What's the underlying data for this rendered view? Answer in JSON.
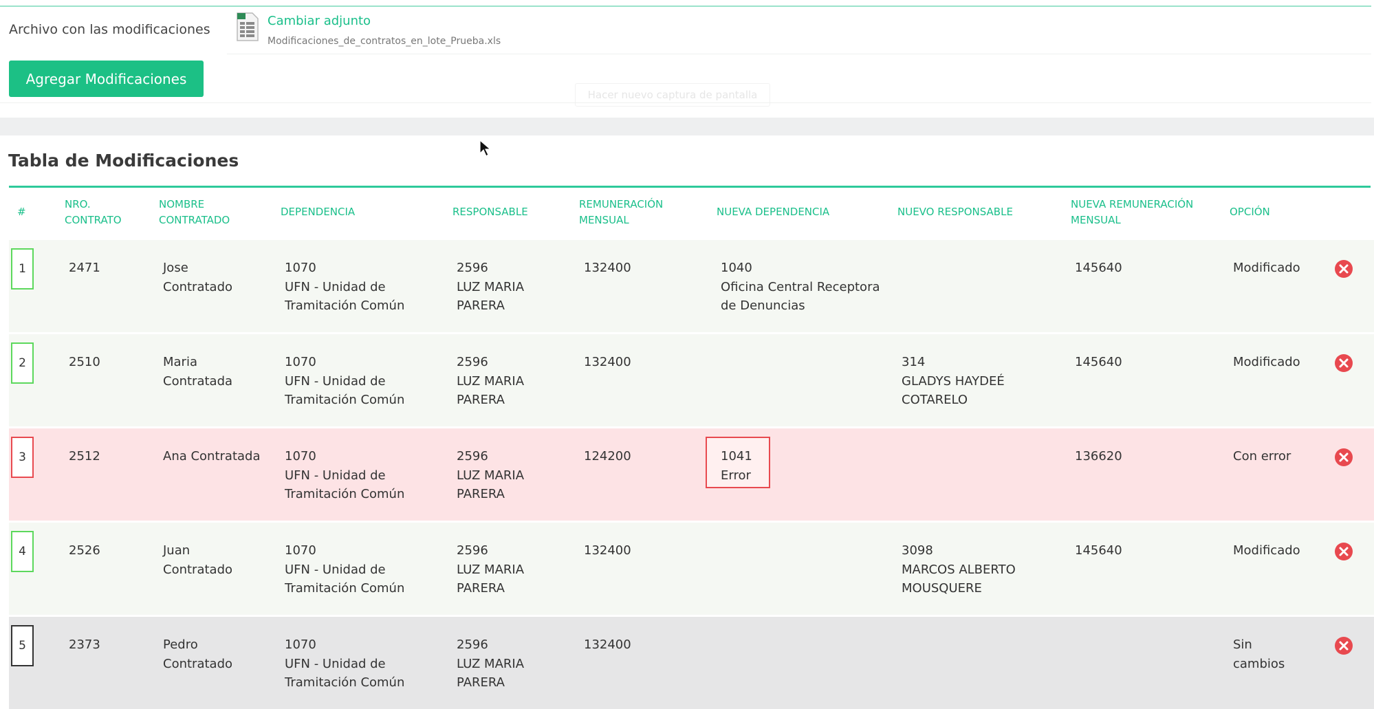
{
  "upload": {
    "label": "Archivo con las modificaciones",
    "change_link": "Cambiar adjunto",
    "file_name": "Modificaciones_de_contratos_en_lote_Prueba.xls",
    "add_button": "Agregar Modificaciones",
    "ghost_button": "Hacer nuevo captura de pantalla"
  },
  "table": {
    "title": "Tabla de Modificaciones",
    "headers": {
      "index": "#",
      "contract_1": "NRO.",
      "contract_2": "CONTRATO",
      "name_1": "NOMBRE",
      "name_2": "CONTRATADO",
      "dependency": "DEPENDENCIA",
      "responsible": "RESPONSABLE",
      "salary_1": "REMUNERACIÓN",
      "salary_2": "MENSUAL",
      "new_dependency": "NUEVA DEPENDENCIA",
      "new_responsible": "NUEVO RESPONSABLE",
      "new_salary_1": "NUEVA REMUNERACIÓN",
      "new_salary_2": "MENSUAL",
      "option": "OPCIÓN"
    },
    "rows": [
      {
        "index": "1",
        "status_type": "ok",
        "contract": "2471",
        "name": [
          "Jose",
          "Contratado"
        ],
        "dependency": [
          "1070",
          "UFN - Unidad de",
          "Tramitación Común"
        ],
        "responsible": [
          "2596",
          "LUZ MARIA",
          "PARERA"
        ],
        "salary": "132400",
        "new_dependency": [
          "1040",
          "Oficina Central Receptora",
          "de Denuncias"
        ],
        "new_responsible": [
          "",
          "",
          ""
        ],
        "new_salary": "145640",
        "option": [
          "Modificado",
          ""
        ]
      },
      {
        "index": "2",
        "status_type": "ok",
        "contract": "2510",
        "name": [
          "Maria",
          "Contratada"
        ],
        "dependency": [
          "1070",
          "UFN - Unidad de",
          "Tramitación Común"
        ],
        "responsible": [
          "2596",
          "LUZ MARIA",
          "PARERA"
        ],
        "salary": "132400",
        "new_dependency": [
          "",
          "",
          ""
        ],
        "new_responsible": [
          "314",
          "GLADYS HAYDEÉ",
          "COTARELO"
        ],
        "new_salary": "145640",
        "option": [
          "Modificado",
          ""
        ]
      },
      {
        "index": "3",
        "status_type": "err",
        "contract": "2512",
        "name": [
          "Ana Contratada",
          ""
        ],
        "dependency": [
          "1070",
          "UFN - Unidad de",
          "Tramitación Común"
        ],
        "responsible": [
          "2596",
          "LUZ MARIA",
          "PARERA"
        ],
        "salary": "124200",
        "new_dependency": [
          "1041",
          "Error",
          ""
        ],
        "new_responsible": [
          "",
          "",
          ""
        ],
        "new_salary": "136620",
        "option": [
          "Con error",
          ""
        ]
      },
      {
        "index": "4",
        "status_type": "ok",
        "contract": "2526",
        "name": [
          "Juan",
          "Contratado"
        ],
        "dependency": [
          "1070",
          "UFN - Unidad de",
          "Tramitación Común"
        ],
        "responsible": [
          "2596",
          "LUZ MARIA",
          "PARERA"
        ],
        "salary": "132400",
        "new_dependency": [
          "",
          "",
          ""
        ],
        "new_responsible": [
          "3098",
          "MARCOS ALBERTO",
          "MOUSQUERE"
        ],
        "new_salary": "145640",
        "option": [
          "Modificado",
          ""
        ]
      },
      {
        "index": "5",
        "status_type": "none",
        "contract": "2373",
        "name": [
          "Pedro",
          "Contratado"
        ],
        "dependency": [
          "1070",
          "UFN - Unidad de",
          "Tramitación Común"
        ],
        "responsible": [
          "2596",
          "LUZ MARIA",
          "PARERA"
        ],
        "salary": "132400",
        "new_dependency": [
          "",
          "",
          ""
        ],
        "new_responsible": [
          "",
          "",
          ""
        ],
        "new_salary": "",
        "option": [
          "Sin",
          "cambios"
        ]
      }
    ]
  },
  "colors": {
    "accent": "#1cc085",
    "row_ok": "#f5f8f3",
    "row_error": "#fde3e5",
    "row_unchanged": "#e6e6e7",
    "remove_icon": "#e8494f"
  },
  "icons": {
    "file": "spreadsheet-file-icon",
    "remove": "remove-circle-x-icon",
    "cursor": "mouse-cursor-icon"
  }
}
